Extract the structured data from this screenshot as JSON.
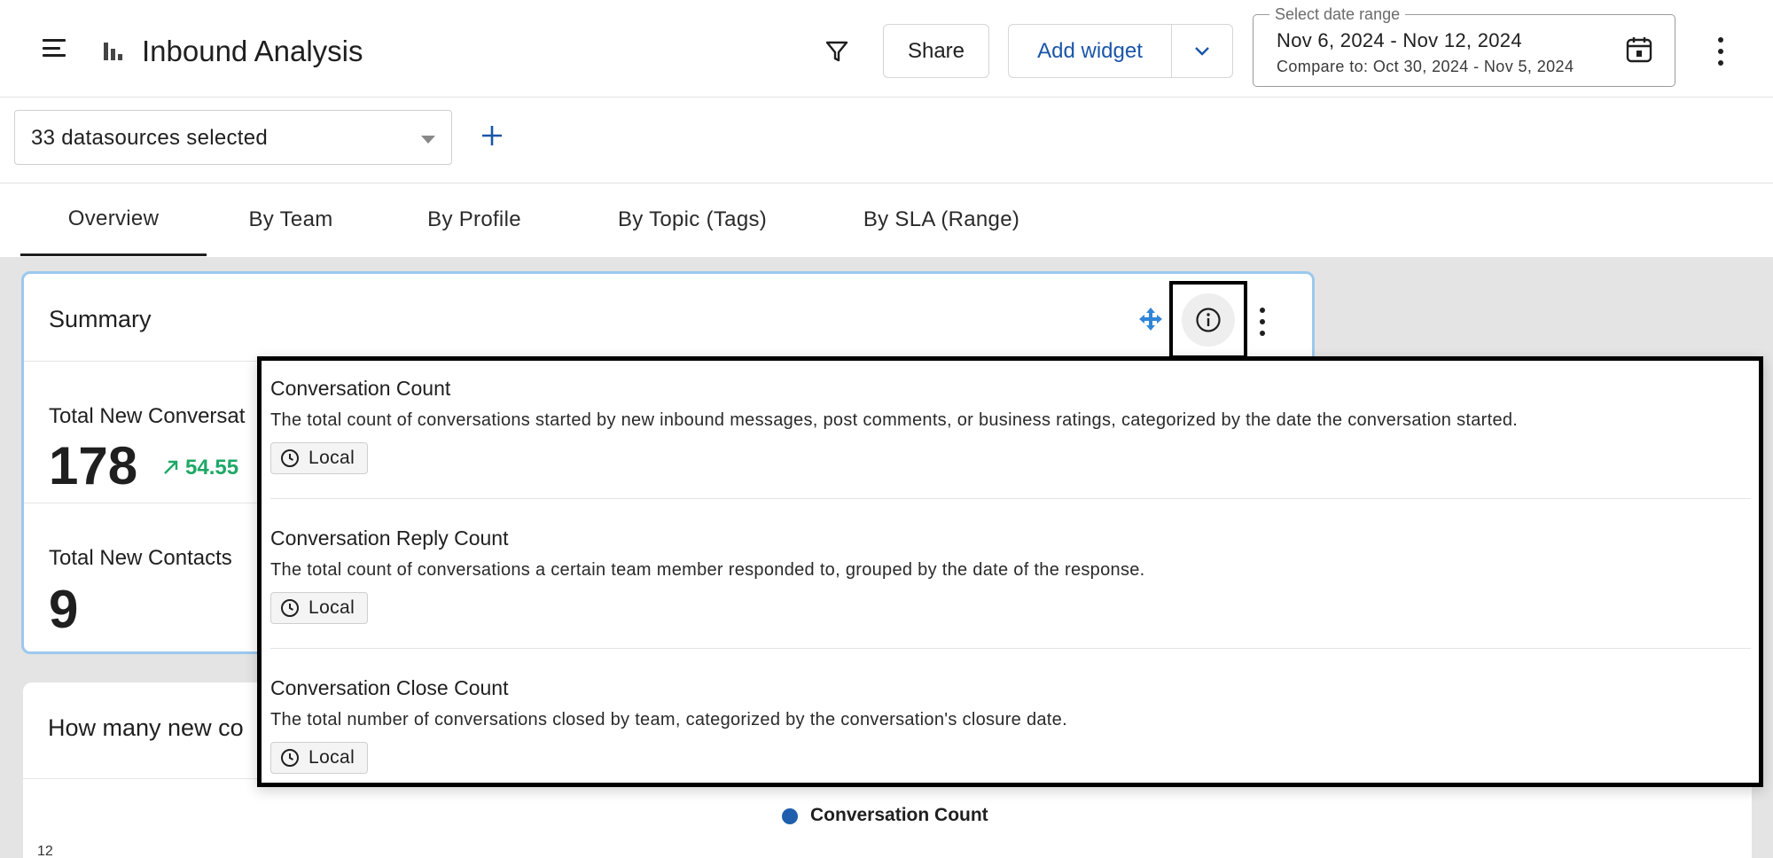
{
  "header": {
    "title": "Inbound Analysis",
    "share_label": "Share",
    "add_widget_label": "Add widget",
    "date_range": {
      "legend": "Select date range",
      "range": "Nov 6, 2024 - Nov 12, 2024",
      "compare": "Compare to: Oct 30, 2024 - Nov 5, 2024"
    }
  },
  "datasources": {
    "selected_label": "33 datasources selected"
  },
  "tabs": [
    {
      "label": "Overview",
      "active": true
    },
    {
      "label": "By Team",
      "active": false
    },
    {
      "label": "By Profile",
      "active": false
    },
    {
      "label": "By Topic (Tags)",
      "active": false
    },
    {
      "label": "By SLA (Range)",
      "active": false
    }
  ],
  "summary": {
    "title": "Summary",
    "metrics": [
      {
        "label": "Total New Conversat",
        "value": "178",
        "change": "54.55"
      },
      {
        "label": "Total New Contacts",
        "value": "9"
      }
    ]
  },
  "chart_card": {
    "title": "How many new co",
    "legend": "Conversation Count",
    "y_tick_top": "12"
  },
  "popover": {
    "items": [
      {
        "title": "Conversation Count",
        "description": "The total count of conversations started by new inbound messages, post comments, or business ratings, categorized by the date the conversation started.",
        "tag": "Local"
      },
      {
        "title": "Conversation Reply Count",
        "description": "The total count of conversations a certain team member responded to, grouped by the date of the response.",
        "tag": "Local"
      },
      {
        "title": "Conversation Close Count",
        "description": "The total number of conversations closed by team, categorized by the conversation's closure date.",
        "tag": "Local"
      }
    ]
  },
  "icons": {
    "menu": "hamburger-icon",
    "report": "bar-chart-icon",
    "filter": "filter-icon",
    "dropdown": "chevron-down-icon",
    "calendar": "calendar-icon",
    "more": "kebab-icon",
    "add": "plus-icon",
    "move": "move-icon",
    "info": "info-icon",
    "clock": "clock-icon"
  },
  "colors": {
    "accent": "#1a56a8",
    "positive": "#1ea866",
    "card_highlight": "#9cc8ee",
    "legend_series": "#1f5fad"
  }
}
